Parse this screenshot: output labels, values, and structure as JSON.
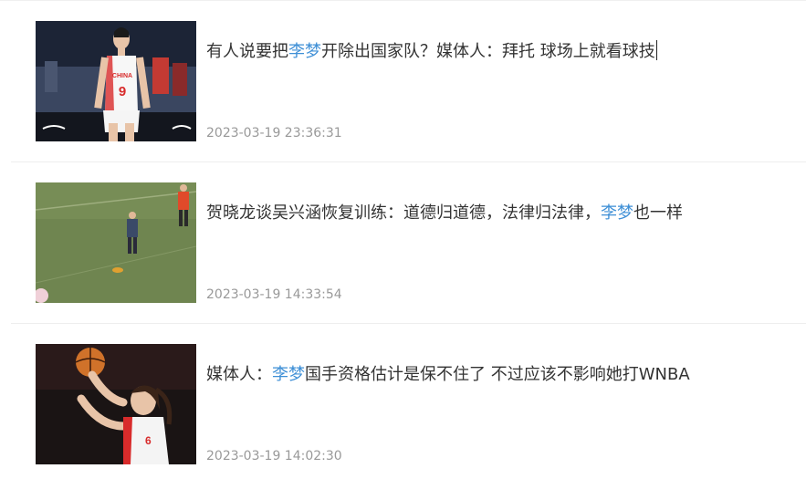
{
  "news": [
    {
      "image": "basketball-player-number-9-photo",
      "title_parts": [
        "有人说要把",
        "李梦",
        "开除出国家队？媒体人：拜托 球场上就看球技"
      ],
      "highlight_color": "#3e8fd6",
      "jersey_text": "CHINA",
      "jersey_number": "9",
      "time": "2023-03-19 23:36:31"
    },
    {
      "image": "training-field-photo",
      "title_parts": [
        "贺晓龙谈吴兴涵恢复训练：道德归道德，法律归法律，",
        "李梦",
        "也一样"
      ],
      "highlight_color": "#3e8fd6",
      "time": "2023-03-19 14:33:54"
    },
    {
      "image": "layup-action-photo",
      "title_parts": [
        "媒体人：",
        "李梦",
        "国手资格估计是保不住了 不过应该不影响她打WNBA"
      ],
      "highlight_color": "#3e8fd6",
      "time": "2023-03-19 14:02:30"
    }
  ]
}
